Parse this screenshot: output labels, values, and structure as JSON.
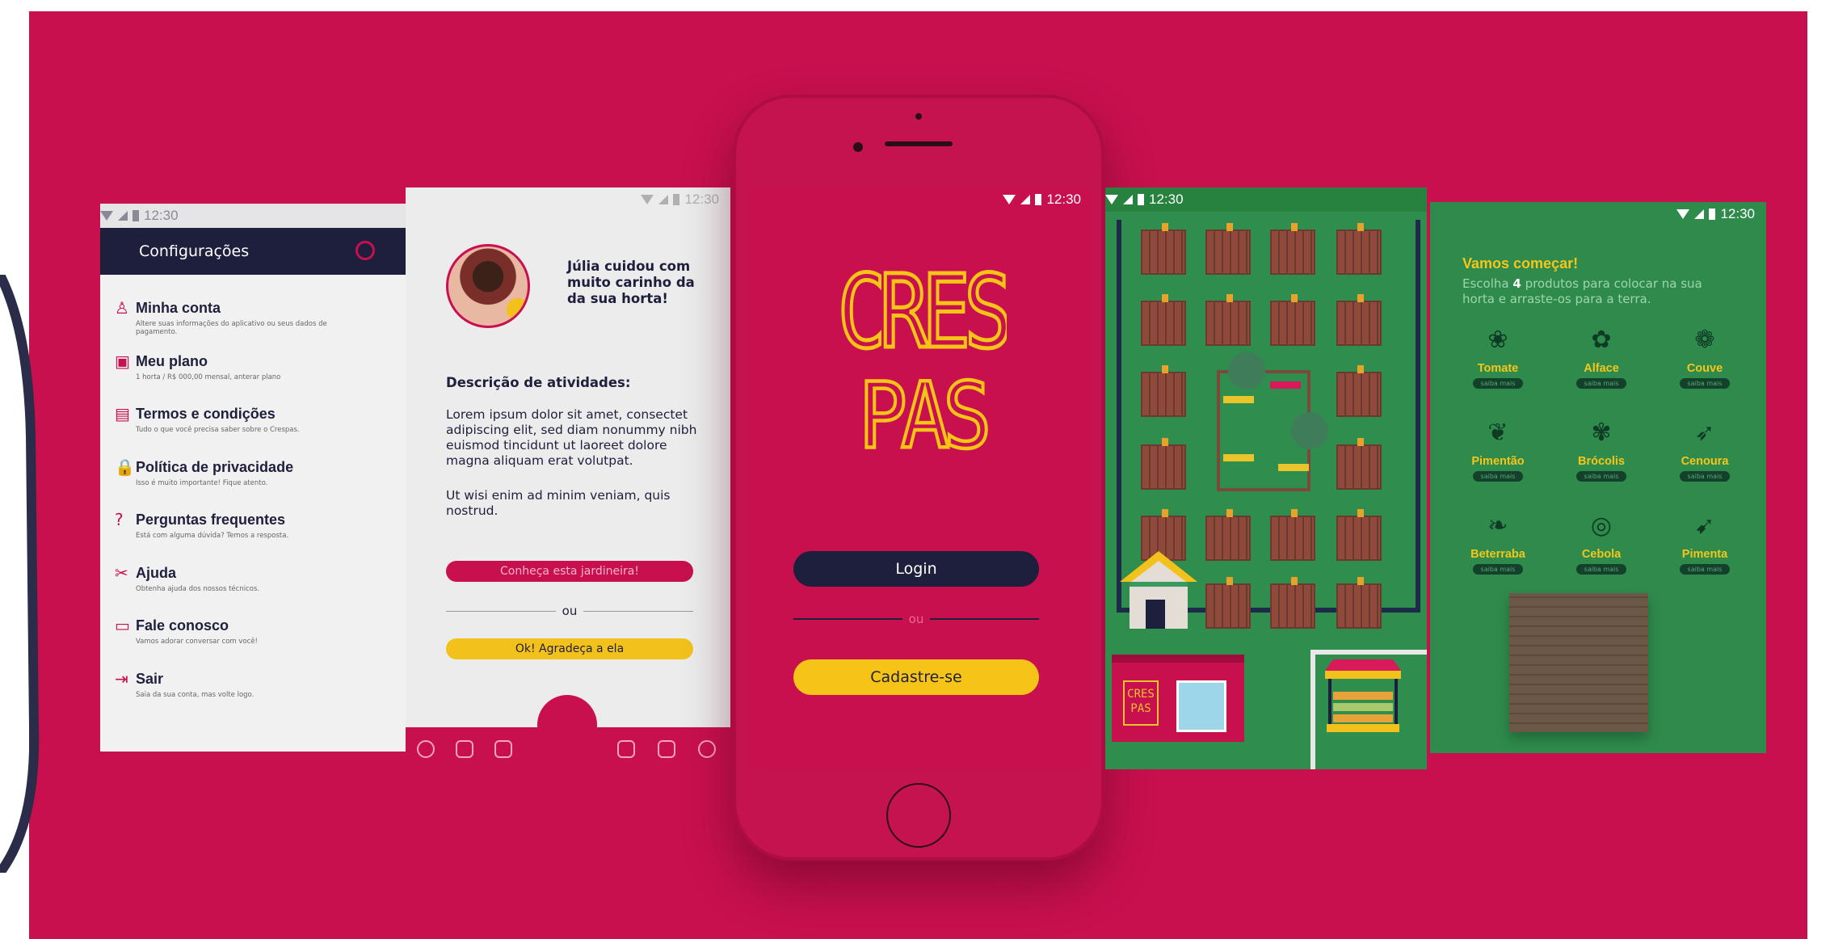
{
  "status": {
    "time": "12:30"
  },
  "settings": {
    "title": "Configurações",
    "items": [
      {
        "icon": "user-icon",
        "glyph": "♙",
        "title": "Minha conta",
        "subtitle": "Altere suas informações do aplicativo ou seus dados de pagamento."
      },
      {
        "icon": "plan-icon",
        "glyph": "▣",
        "title": "Meu plano",
        "subtitle": "1 horta / R$ 000,00 mensal, anterar plano"
      },
      {
        "icon": "document-icon",
        "glyph": "▤",
        "title": "Termos e condições",
        "subtitle": "Tudo o que você precisa saber sobre o Crespas."
      },
      {
        "icon": "lock-icon",
        "glyph": "🔒",
        "title": "Política de privacidade",
        "subtitle": "Isso é muito importante! Fique atento."
      },
      {
        "icon": "question-icon",
        "glyph": "?",
        "title": "Perguntas frequentes",
        "subtitle": "Está com alguma dúvida? Temos a resposta."
      },
      {
        "icon": "tools-icon",
        "glyph": "✂",
        "title": "Ajuda",
        "subtitle": "Obtenha ajuda dos nossos técnicos."
      },
      {
        "icon": "chat-icon",
        "glyph": "▭",
        "title": "Fale conosco",
        "subtitle": "Vamos adorar conversar com você!"
      },
      {
        "icon": "logout-icon",
        "glyph": "⇥",
        "title": "Sair",
        "subtitle": "Saia da sua conta, mas volte logo."
      }
    ]
  },
  "feedback": {
    "headline": "Júlia cuidou com muito carinho da da sua horta!",
    "section_title": "Descrição de atividades:",
    "paragraph1": "Lorem ipsum dolor sit amet, consectet adipiscing elit, sed diam nonummy nibh euismod tincidunt ut laoreet dolore magna aliquam erat volutpat.",
    "paragraph2": "Ut wisi enim ad minim veniam, quis nostrud.",
    "btn_primary": "Conheça esta jardineira!",
    "or": "ou",
    "btn_secondary": "Ok! Agradeça a ela"
  },
  "login": {
    "logo_line1": "CRES",
    "logo_line2": "PAS",
    "login_label": "Login",
    "or": "ou",
    "signup_label": "Cadastre-se"
  },
  "map": {
    "shop_sign_line1": "CRES",
    "shop_sign_line2": "PAS"
  },
  "products": {
    "title": "Vamos começar!",
    "subtitle_pre": "Escolha ",
    "subtitle_count": "4",
    "subtitle_post": " produtos para colocar na sua horta e arraste-os para a terra.",
    "more_label": "saiba mais",
    "items": [
      {
        "name": "Tomate",
        "glyph": "❀",
        "icon": "tomato-icon"
      },
      {
        "name": "Alface",
        "glyph": "✿",
        "icon": "lettuce-icon"
      },
      {
        "name": "Couve",
        "glyph": "❁",
        "icon": "kale-icon"
      },
      {
        "name": "Pimentão",
        "glyph": "❦",
        "icon": "bell-pepper-icon"
      },
      {
        "name": "Brócolis",
        "glyph": "✾",
        "icon": "broccoli-icon"
      },
      {
        "name": "Cenoura",
        "glyph": "➶",
        "icon": "carrot-icon"
      },
      {
        "name": "Beterraba",
        "glyph": "❧",
        "icon": "beet-icon"
      },
      {
        "name": "Cebola",
        "glyph": "◎",
        "icon": "onion-icon"
      },
      {
        "name": "Pimenta",
        "glyph": "➹",
        "icon": "chili-icon"
      }
    ]
  },
  "colors": {
    "brand": "#c8104f",
    "navy": "#1e1f3d",
    "yellow": "#f6c417",
    "green": "#2e8b4c"
  }
}
